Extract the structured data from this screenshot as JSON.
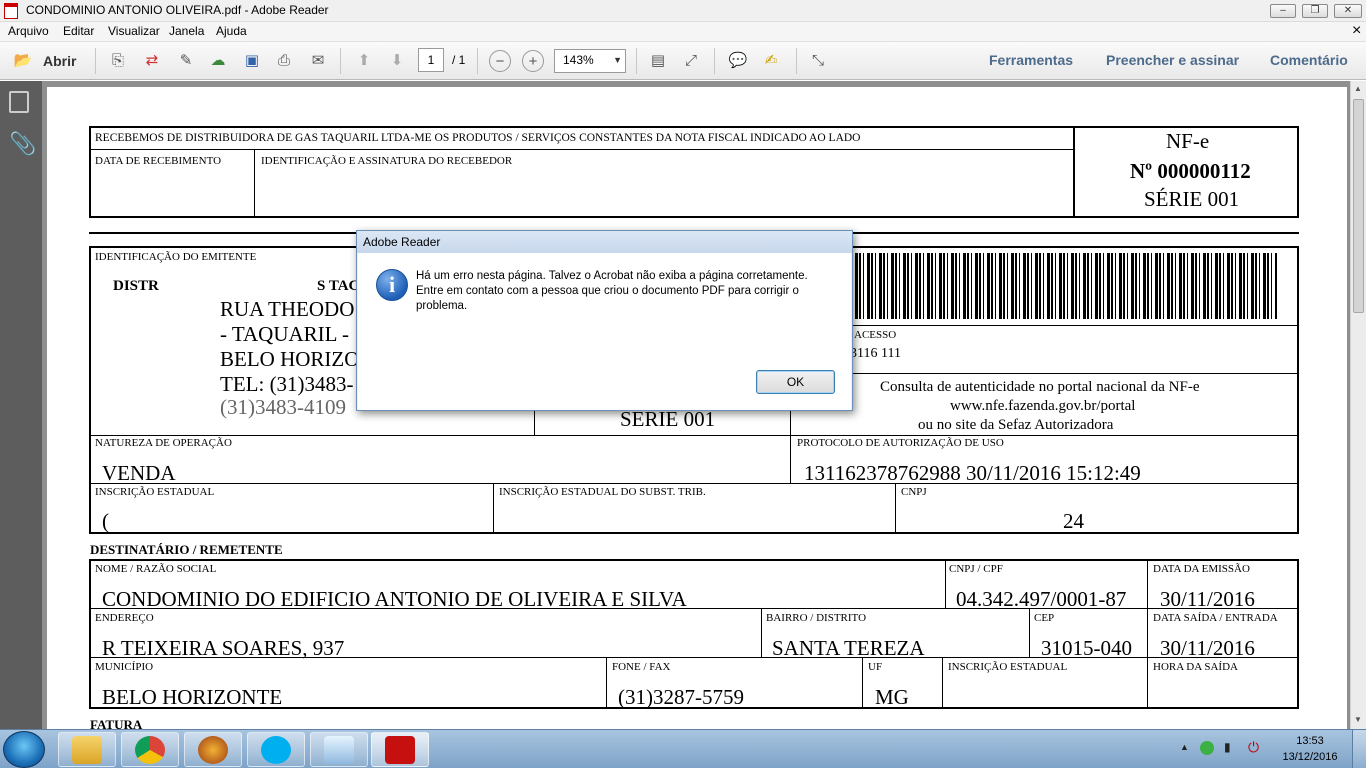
{
  "window": {
    "title": "CONDOMINIO ANTONIO OLIVEIRA.pdf - Adobe Reader"
  },
  "menu": [
    "Arquivo",
    "Editar",
    "Visualizar",
    "Janela",
    "Ajuda"
  ],
  "menu_close": "×",
  "toolbar": {
    "open_label": "Abrir",
    "page_current": "1",
    "page_total": "/ 1",
    "zoom": "143%",
    "links": [
      "Ferramentas",
      "Preencher e assinar",
      "Comentário"
    ]
  },
  "receipt": {
    "header": "RECEBEMOS DE DISTRIBUIDORA DE GAS TAQUARIL LTDA-ME OS PRODUTOS / SERVIÇOS CONSTANTES DA NOTA FISCAL INDICADO AO LADO",
    "date_label": "DATA DE RECEBIMENTO",
    "sign_label": "IDENTIFICAÇÃO E ASSINATURA DO RECEBEDOR",
    "nfe": "NF-e",
    "number": "Nº 000000112",
    "series": "SÉRIE 001"
  },
  "issuer": {
    "label": "IDENTIFICAÇÃO DO EMITENTE",
    "name_a": "DISTR",
    "name_b": "S TAC",
    "line1": "RUA THEODO",
    "line2": "- TAQUARIL -",
    "line3": "BELO HORIZO",
    "line4": "TEL: (31)3483-",
    "line5": "(31)3483-4109",
    "series": "SÉRIE 001"
  },
  "access": {
    "label": "ACESSO",
    "key": "3116 111",
    "consult1": "Consulta de autenticidade no portal nacional da NF-e",
    "consult2": "www.nfe.fazenda.gov.br/portal",
    "consult3": "ou no site da Sefaz Autorizadora"
  },
  "operation": {
    "nature_label": "NATUREZA DE OPERAÇÃO",
    "nature": "VENDA",
    "protocol_label": "PROTOCOLO DE AUTORIZAÇÃO DE USO",
    "protocol": "131162378762988 30/11/2016 15:12:49",
    "ie_label": "INSCRIÇÃO ESTADUAL",
    "ie": "(",
    "ie_st_label": "INSCRIÇÃO ESTADUAL DO SUBST. TRIB.",
    "cnpj_label": "CNPJ",
    "cnpj": "24"
  },
  "recipient": {
    "section": "DESTINATÁRIO / REMETENTE",
    "name_label": "NOME / RAZÃO SOCIAL",
    "name": "CONDOMINIO DO EDIFICIO ANTONIO DE OLIVEIRA E SILVA",
    "cnpj_label": "CNPJ / CPF",
    "cnpj": "04.342.497/0001-87",
    "emission_label": "DATA DA EMISSÃO",
    "emission": "30/11/2016",
    "address_label": "ENDEREÇO",
    "address": "R TEIXEIRA SOARES, 937",
    "district_label": "BAIRRO / DISTRITO",
    "district": "SANTA TEREZA",
    "cep_label": "CEP",
    "cep": "31015-040",
    "exit_label": "DATA SAÍDA / ENTRADA",
    "exit": "30/11/2016",
    "city_label": "MUNICÍPIO",
    "city": "BELO HORIZONTE",
    "phone_label": "FONE / FAX",
    "phone": "(31)3287-5759",
    "uf_label": "UF",
    "uf": "MG",
    "ie_label": "INSCRIÇÃO ESTADUAL",
    "time_label": "HORA DA SAÍDA"
  },
  "invoice_section": "FATURA",
  "dialog": {
    "title": "Adobe Reader",
    "message": "Há um erro nesta página. Talvez o Acrobat não exiba a página corretamente. Entre em contato com a pessoa que criou o documento PDF para corrigir o problema.",
    "ok": "OK"
  },
  "taskbar": {
    "time": "13:53",
    "date": "13/12/2016"
  },
  "colors": {
    "accent_link": "#4d6b8b",
    "doc_bg": "#8f8f8f",
    "taskbar": "#7ea3c8"
  }
}
